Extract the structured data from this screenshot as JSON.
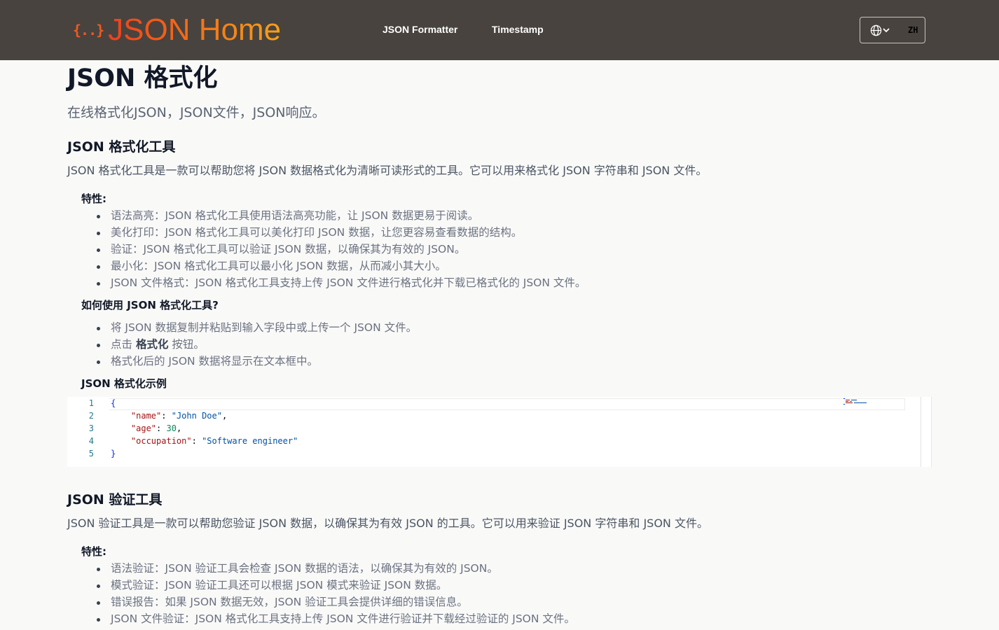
{
  "header": {
    "logo_icon": "{..}",
    "logo_text": "JSON Home",
    "nav": [
      "JSON Formatter",
      "Timestamp"
    ],
    "language": "ZH"
  },
  "page": {
    "title": "JSON 格式化",
    "subtitle": "在线格式化JSON，JSON文件，JSON响应。"
  },
  "formatter": {
    "heading": "JSON 格式化工具",
    "intro": "JSON 格式化工具是一款可以帮助您将 JSON 数据格式化为清晰可读形式的工具。它可以用来格式化 JSON 字符串和 JSON 文件。",
    "features_heading": "特性:",
    "features": [
      "语法高亮：JSON 格式化工具使用语法高亮功能，让 JSON 数据更易于阅读。",
      "美化打印：JSON 格式化工具可以美化打印 JSON 数据，让您更容易查看数据的结构。",
      "验证：JSON 格式化工具可以验证 JSON 数据，以确保其为有效的 JSON。",
      "最小化：JSON 格式化工具可以最小化 JSON 数据，从而减小其大小。",
      "JSON 文件格式：JSON 格式化工具支持上传 JSON 文件进行格式化并下载已格式化的 JSON 文件。"
    ],
    "howto_heading": "如何使用 JSON 格式化工具?",
    "howto": {
      "step1": "将 JSON 数据复制并粘贴到输入字段中或上传一个 JSON 文件。",
      "step2_pre": "点击 ",
      "step2_bold": "格式化",
      "step2_post": " 按钮。",
      "step3": "格式化后的 JSON 数据将显示在文本框中。"
    },
    "example_heading": "JSON 格式化示例",
    "example": {
      "line_numbers": [
        "1",
        "2",
        "3",
        "4",
        "5"
      ],
      "open_brace": "{",
      "close_brace": "}",
      "key_name": "\"name\"",
      "val_name": "\"John Doe\"",
      "key_age": "\"age\"",
      "val_age": "30",
      "key_occupation": "\"occupation\"",
      "val_occupation": "\"Software engineer\""
    }
  },
  "validator": {
    "heading": "JSON 验证工具",
    "intro": "JSON 验证工具是一款可以帮助您验证 JSON 数据，以确保其为有效 JSON 的工具。它可以用来验证 JSON 字符串和 JSON 文件。",
    "features_heading": "特性:",
    "features": [
      "语法验证：JSON 验证工具会检查 JSON 数据的语法，以确保其为有效的 JSON。",
      "模式验证：JSON 验证工具还可以根据 JSON 模式来验证 JSON 数据。",
      "错误报告：如果 JSON 数据无效，JSON 验证工具会提供详细的错误信息。",
      "JSON 文件验证：JSON 格式化工具支持上传 JSON 文件进行验证并下载经过验证的 JSON 文件。"
    ]
  }
}
